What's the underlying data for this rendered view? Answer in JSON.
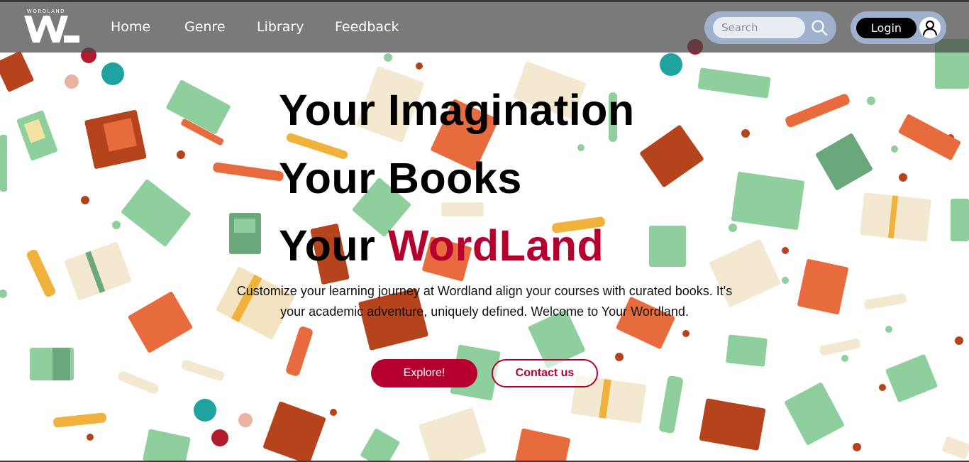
{
  "brand": {
    "logo_small_text": "WORDLAND",
    "logo_mark": "WL"
  },
  "nav": {
    "links": [
      {
        "label": "Home"
      },
      {
        "label": "Genre"
      },
      {
        "label": "Library"
      },
      {
        "label": "Feedback"
      }
    ]
  },
  "search": {
    "placeholder": "Search",
    "icon": "search-icon"
  },
  "auth": {
    "login_label": "Login",
    "user_icon": "user-icon"
  },
  "hero": {
    "line1": "Your Imagination",
    "line2": "Your Books",
    "line3_prefix": "Your ",
    "line3_accent": "WordLand",
    "description": "Customize your learning journey at Wordland align your courses with curated books. It's your academic adventure, uniquely defined. Welcome to Your Wordland.",
    "explore_label": "Explore!",
    "contact_label": "Contact us"
  },
  "colors": {
    "accent": "#b5002f",
    "navbar": "#464646",
    "pill": "#9fb1cc"
  }
}
